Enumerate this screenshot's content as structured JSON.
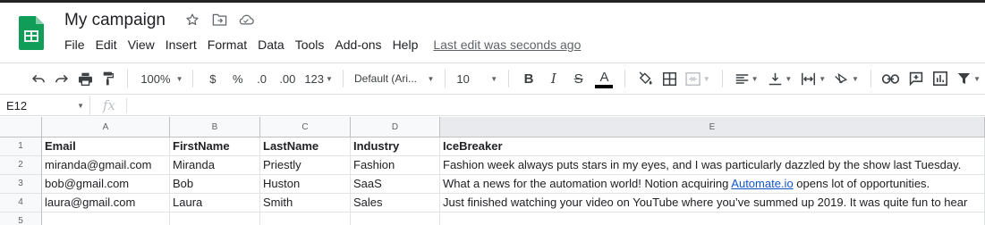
{
  "app": {
    "title": "My campaign",
    "last_edit": "Last edit was seconds ago"
  },
  "colors": {
    "brand_green": "#0f9d58",
    "link": "#1155cc",
    "header_bg": "#f8f9fa"
  },
  "menu": [
    "File",
    "Edit",
    "View",
    "Insert",
    "Format",
    "Data",
    "Tools",
    "Add-ons",
    "Help"
  ],
  "toolbar": {
    "zoom": "100%",
    "currency": "$",
    "percent": "%",
    "dec_decrease": ".0",
    "dec_increase": ".00",
    "more_formats": "123",
    "font": "Default (Ari...",
    "font_size": "10",
    "bold": "B",
    "italic": "I",
    "strike": "S",
    "text_color": "A"
  },
  "formula_bar": {
    "cell_ref": "E12",
    "fx": "fx",
    "value": ""
  },
  "sheet": {
    "columns": [
      "A",
      "B",
      "C",
      "D",
      "E"
    ],
    "rows": [
      {
        "num": "1",
        "cells": [
          "Email",
          "FirstName",
          "LastName",
          "Industry",
          "IceBreaker"
        ]
      },
      {
        "num": "2",
        "cells": [
          "miranda@gmail.com",
          "Miranda",
          "Priestly",
          "Fashion",
          "Fashion week always puts stars in my eyes, and I was particularly dazzled by the show last Tuesday."
        ]
      },
      {
        "num": "3",
        "cells": [
          "bob@gmail.com",
          "Bob",
          "Huston",
          "SaaS",
          "What a news for the automation world! Notion acquiring "
        ],
        "e_link": "Automate.io",
        "e_after": " opens lot of opportunities."
      },
      {
        "num": "4",
        "cells": [
          "laura@gmail.com",
          "Laura",
          "Smith",
          "Sales",
          "Just finished watching your video on YouTube where you’ve summed up 2019. It was quite fun to hear"
        ]
      },
      {
        "num": "5",
        "cells": [
          "",
          "",
          "",
          "",
          ""
        ]
      }
    ]
  }
}
